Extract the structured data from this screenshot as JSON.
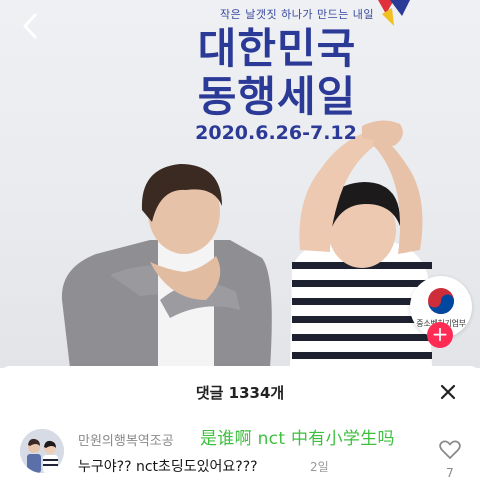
{
  "video": {
    "poster_tagline": "작은 날갯짓 하나가 만드는 내일",
    "poster_title_line1": "대한민국",
    "poster_title_line2": "동행세일",
    "poster_dates": "2020.6.26-7.12",
    "creator_badge_label": "중소벤처기업부",
    "icons": {
      "back": "chevron-left-icon",
      "follow": "plus-icon",
      "badge": "taegeuk-emblem-icon"
    },
    "colors": {
      "poster_text": "#2b3a96",
      "follow_button": "#fe2c55"
    }
  },
  "comments_sheet": {
    "title": "댓글 1334개",
    "close_icon": "close-icon",
    "comments": [
      {
        "username": "만원의행복역조공",
        "annotation": "是谁啊 nct 中有小学生吗",
        "text": "누구야?? nct초딩도있어요???",
        "time": "2일",
        "likes": "7",
        "like_icon": "heart-outline-icon"
      }
    ],
    "colors": {
      "annotation": "#3fbf3f"
    }
  }
}
